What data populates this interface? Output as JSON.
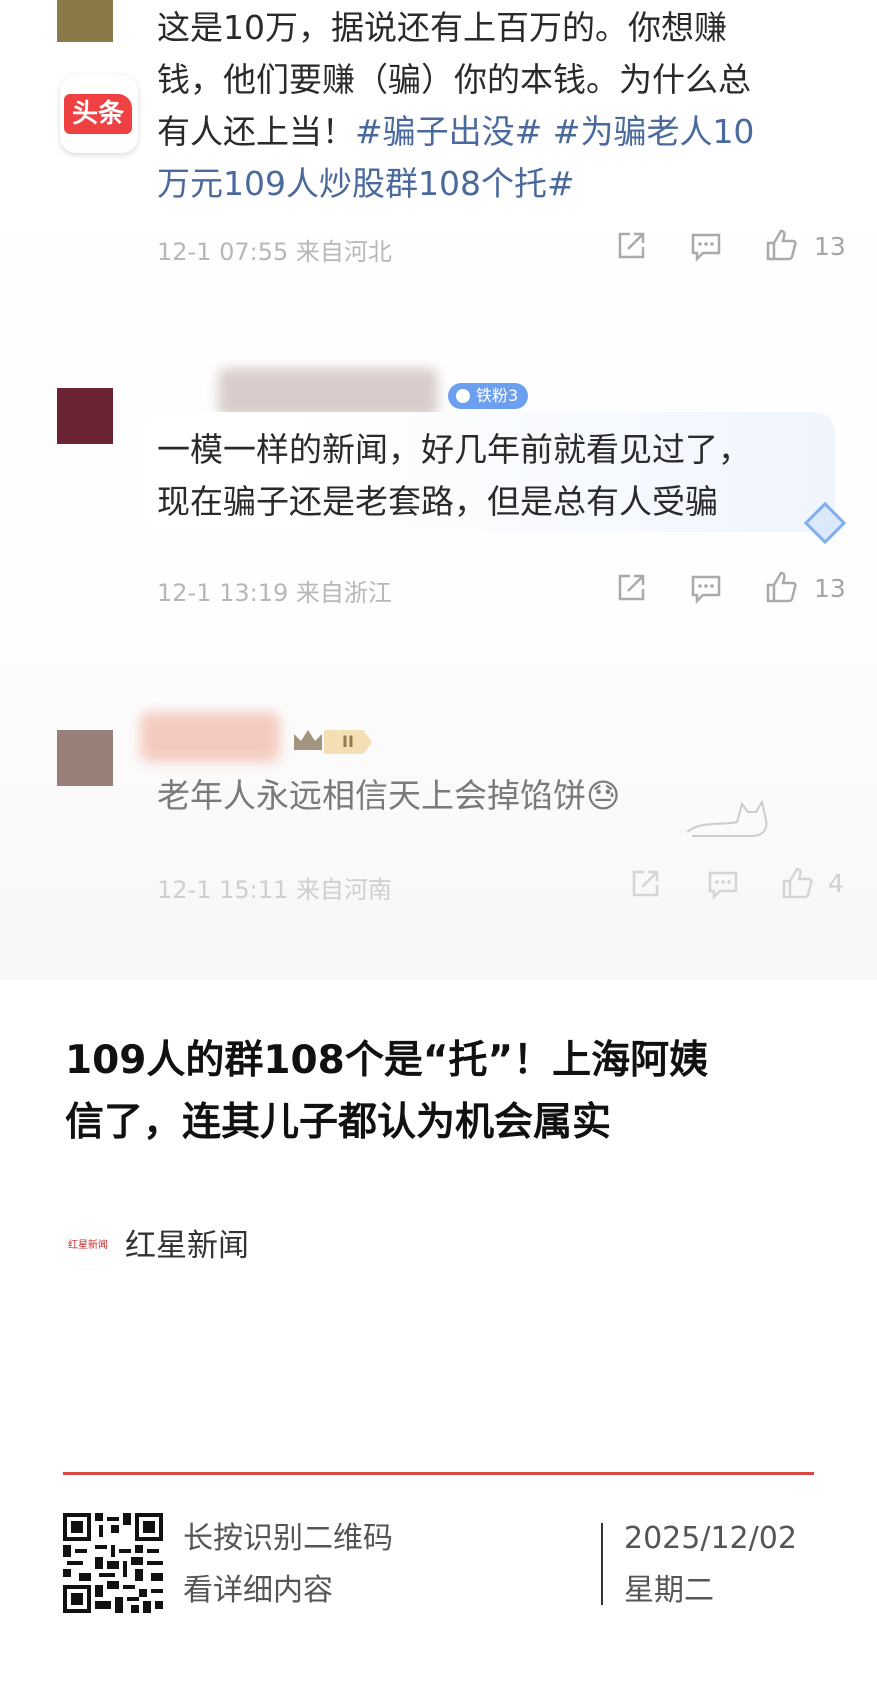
{
  "comments": [
    {
      "text_line1": "这是10万，据说还有上百万的。你想赚",
      "text_line2": "钱，他们要赚（骗）你的本钱。为什么总",
      "text_line3": "有人还上当！",
      "hashtags_line3": "#骗子出没# #为骗老人10",
      "hashtags_line4": "万元109人炒股群108个托#",
      "meta": "12-1 07:55 来自河北",
      "likes": "13"
    },
    {
      "badge": "铁粉3",
      "text_line1": "一模一样的新闻，好几年前就看见过了，",
      "text_line2": "现在骗子还是老套路，但是总有人受骗",
      "meta": "12-1 13:19 来自浙江",
      "likes": "13"
    },
    {
      "badge": "II",
      "text_line1": "老年人永远相信天上会掉馅饼😓",
      "meta": "12-1 15:11 来自河南",
      "likes": "4"
    }
  ],
  "app_badge": "头条",
  "article": {
    "title_line1": "109人的群108个是“托”！上海阿姨",
    "title_line2": "信了，连其儿子都认为机会属实",
    "source_logo_text": "红星新闻",
    "source_name": "红星新闻"
  },
  "footer": {
    "qr_hint_line1": "长按识别二维码",
    "qr_hint_line2": "看详细内容",
    "date": "2025/12/02",
    "weekday": "星期二"
  },
  "colors": {
    "accent_red": "#d9473f",
    "hashtag_blue": "#4a6a9e",
    "toutiao_red": "#f04142"
  },
  "icons": [
    "share-icon",
    "comment-icon",
    "like-icon",
    "qr-code-icon"
  ]
}
